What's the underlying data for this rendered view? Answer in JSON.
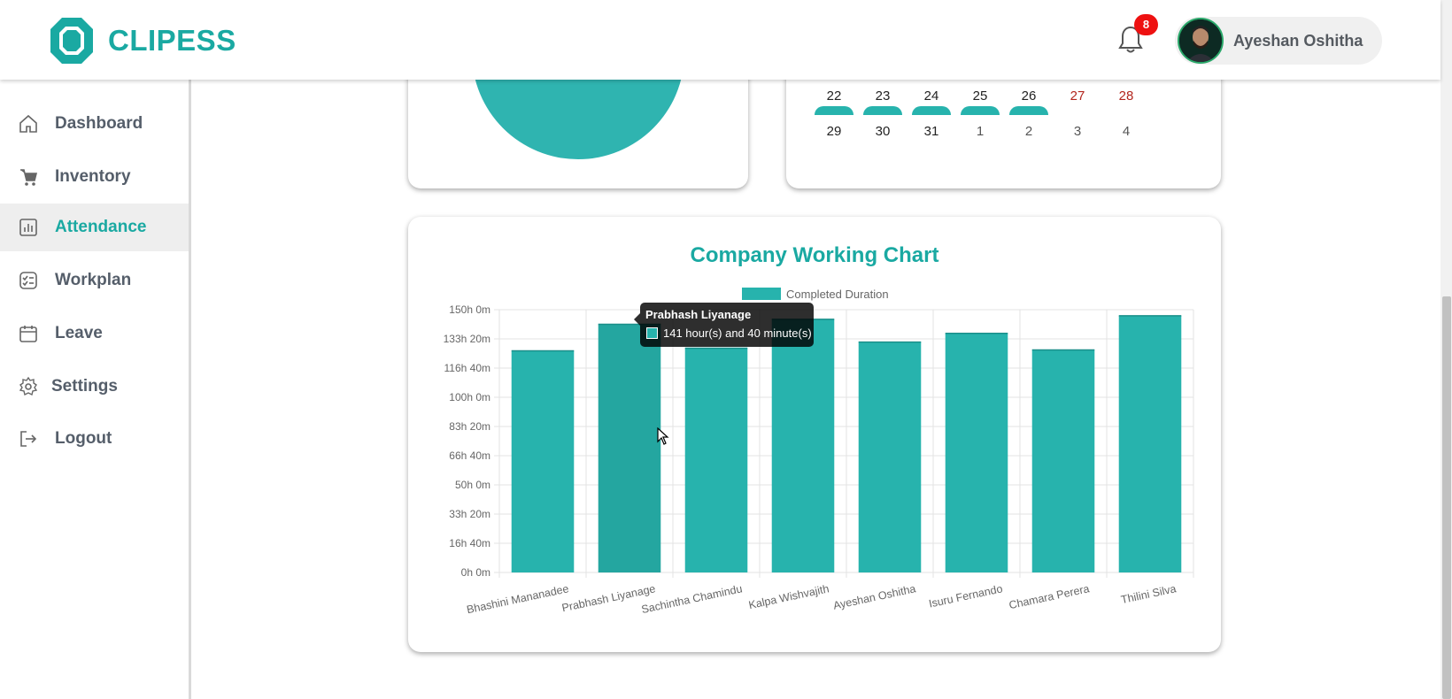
{
  "header": {
    "logo_text": "CLIPESS",
    "logo_icon": "octagon-logo-icon",
    "notification_icon": "bell-icon",
    "notification_count": "8",
    "user_name": "Ayeshan Oshitha"
  },
  "sidebar": {
    "items": [
      {
        "label": "Dashboard",
        "icon": "home-icon"
      },
      {
        "label": "Inventory",
        "icon": "cart-icon"
      },
      {
        "label": "Attendance",
        "icon": "bar-chart-icon",
        "active": true
      },
      {
        "label": "Workplan",
        "icon": "checklist-icon"
      },
      {
        "label": "Leave",
        "icon": "calendar-icon"
      },
      {
        "label": "Settings",
        "icon": "gear-icon"
      },
      {
        "label": "Logout",
        "icon": "logout-icon"
      }
    ]
  },
  "calendar": {
    "row1": [
      "22",
      "23",
      "24",
      "25",
      "26",
      "27",
      "28"
    ],
    "row2": [
      "29",
      "30",
      "31",
      "1",
      "2",
      "3",
      "4"
    ]
  },
  "tooltip": {
    "title": "Prabhash Liyanage",
    "body": "141 hour(s) and 40 minute(s)"
  },
  "colors": {
    "accent": "#1aa9a2",
    "bar": "#27b3ad",
    "weekend": "#b3261e",
    "badge": "#ee1111"
  },
  "chart_data": {
    "type": "bar",
    "title": "Company Working Chart",
    "legend": "Completed Duration",
    "categories": [
      "Bhashini Mananadee",
      "Prabhash Liyanage",
      "Sachintha Chamindu",
      "Kalpa Wishvajith",
      "Ayeshan Oshitha",
      "Isuru Fernando",
      "Chamara Perera",
      "Thilini Silva"
    ],
    "values": [
      126.5,
      141.67,
      128,
      144.5,
      131.5,
      136.5,
      127,
      146.5
    ],
    "unit": "hours",
    "ylim": [
      0,
      150
    ],
    "yticks": [
      "0h 0m",
      "16h 40m",
      "33h 20m",
      "50h 0m",
      "66h 40m",
      "83h 20m",
      "100h 0m",
      "116h 40m",
      "133h 20m",
      "150h 0m"
    ],
    "grid": true,
    "legend_position": "top",
    "highlighted": "Prabhash Liyanage"
  }
}
